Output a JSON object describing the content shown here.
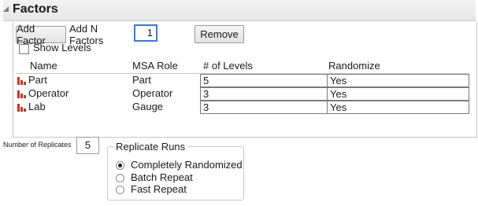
{
  "section": {
    "title": "Factors"
  },
  "toolbar": {
    "add_factor_label": "Add Factor",
    "add_n_factors_label": "Add N Factors",
    "n_factors_value": "1",
    "remove_label": "Remove"
  },
  "show_levels": {
    "label": "Show Levels",
    "checked": false
  },
  "table": {
    "headers": {
      "name": "Name",
      "msa_role": "MSA Role",
      "levels": "# of Levels",
      "randomize": "Randomize"
    },
    "rows": [
      {
        "name": "Part",
        "msa_role": "Part",
        "levels": "5",
        "randomize": "Yes"
      },
      {
        "name": "Operator",
        "msa_role": "Operator",
        "levels": "3",
        "randomize": "Yes"
      },
      {
        "name": "Lab",
        "msa_role": "Gauge",
        "levels": "3",
        "randomize": "Yes"
      }
    ]
  },
  "replicates": {
    "label": "Number of Replicates",
    "value": "5"
  },
  "replicate_runs": {
    "title": "Replicate Runs",
    "options": [
      {
        "label": "Completely Randomized",
        "selected": true
      },
      {
        "label": "Batch Repeat",
        "selected": false
      },
      {
        "label": "Fast Repeat",
        "selected": false
      }
    ]
  },
  "colors": {
    "factor_icon": "#c0392b",
    "focus_border": "#3c78d8"
  },
  "icons": {
    "factor": "factor-bar-chart-icon",
    "collapse": "disclosure-triangle-icon"
  }
}
